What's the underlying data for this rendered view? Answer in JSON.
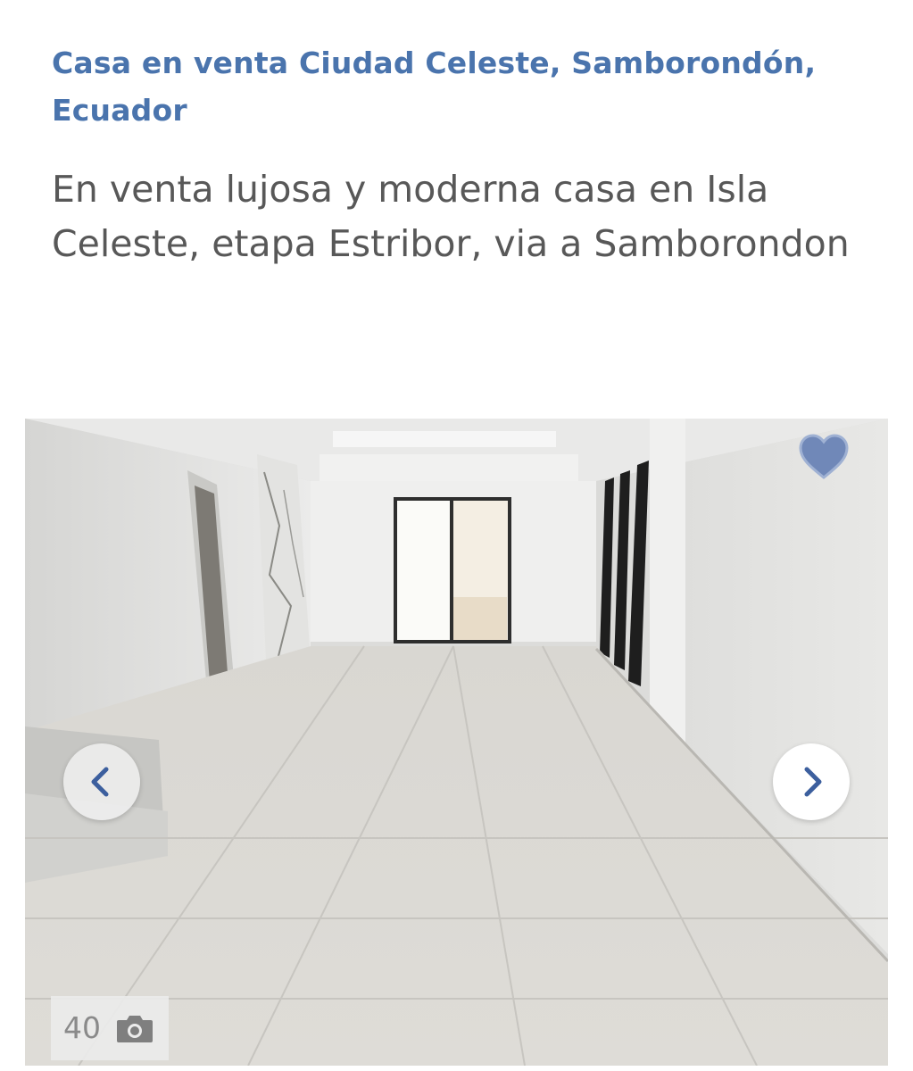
{
  "listing": {
    "title": "Casa en venta Ciudad Celeste, Samborondón, Ecuador",
    "description": "En venta lujosa y moderna casa en Isla Celeste, etapa Estribor, via a Samborondon"
  },
  "gallery": {
    "photo_count": "40",
    "icons": {
      "favorite": "heart-icon",
      "previous": "chevron-left-icon",
      "next": "chevron-right-icon",
      "count": "camera-icon"
    }
  },
  "colors": {
    "title": "#4a74ad",
    "description": "#585858",
    "accent": "#3c5f9e",
    "heart": "#6f86b6"
  }
}
